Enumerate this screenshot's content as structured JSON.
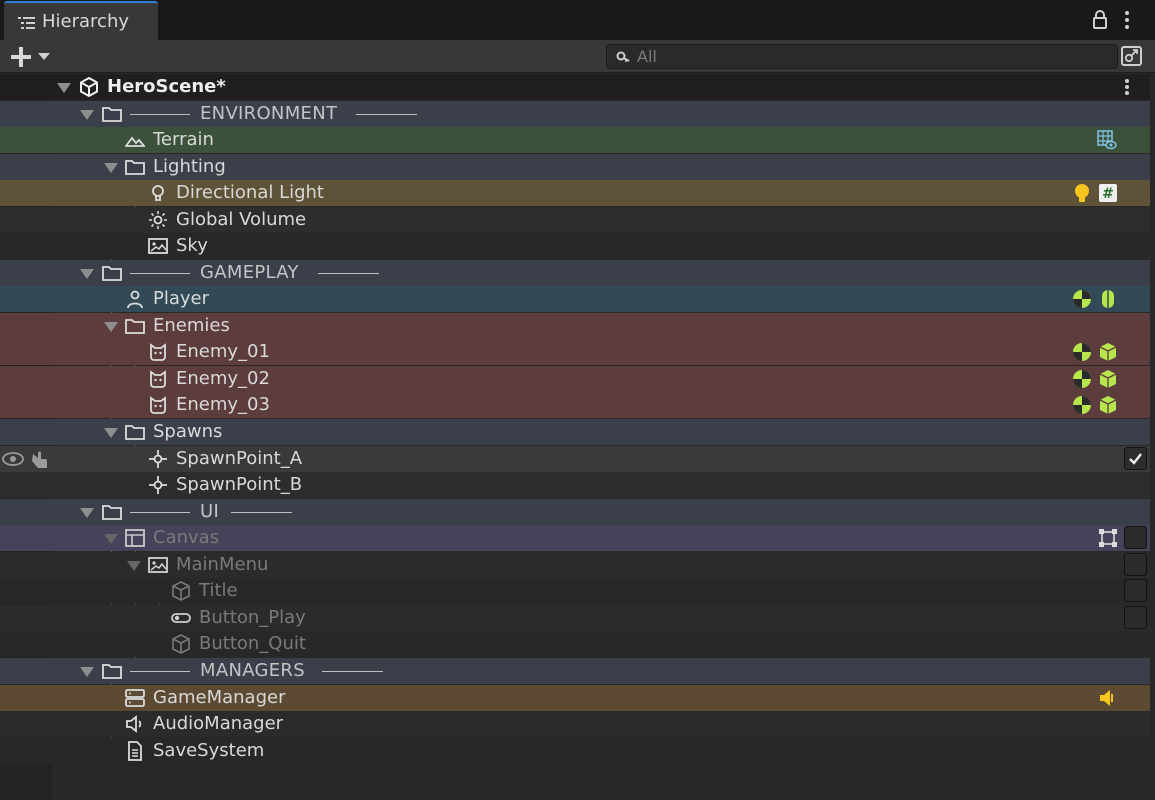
{
  "window": {
    "tab_title": "Hierarchy"
  },
  "toolbar": {
    "search_placeholder": "All"
  },
  "scene": {
    "name": "HeroScene*"
  },
  "rows": {
    "environment": "ENVIRONMENT",
    "terrain": "Terrain",
    "lighting": "Lighting",
    "directional_light": "Directional Light",
    "global_volume": "Global Volume",
    "sky": "Sky",
    "gameplay": "GAMEPLAY",
    "player": "Player",
    "enemies": "Enemies",
    "enemy_01": "Enemy_01",
    "enemy_02": "Enemy_02",
    "enemy_03": "Enemy_03",
    "spawns": "Spawns",
    "spawnpoint_a": "SpawnPoint_A",
    "spawnpoint_b": "SpawnPoint_B",
    "ui": "UI",
    "canvas": "Canvas",
    "mainmenu": "MainMenu",
    "title": "Title",
    "button_play": "Button_Play",
    "button_quit": "Button_Quit",
    "managers": "MANAGERS",
    "gamemanager": "GameManager",
    "audiomanager": "AudioManager",
    "savesystem": "SaveSystem"
  },
  "colors": {
    "header_row": "#3a3f4a",
    "terrain_row": "#3b5139",
    "light_row": "#5e5338",
    "player_row": "#314a56",
    "enemy_row": "#5c3c3c",
    "canvas_row": "#45425a",
    "gamemanager_row": "#5c4a33",
    "selected_row": "#3a3a3a",
    "accent_green": "#b7e64c",
    "accent_yellow": "#f7c520",
    "accent_blue": "#7fc4e8"
  },
  "icons": {
    "row_toggles": [
      "checkbox-checked-icon",
      "checkbox-empty-icon"
    ],
    "components": [
      "grid-eye-icon",
      "bulb-icon",
      "hash-script-icon",
      "physics-ball-icon",
      "capsule-icon",
      "cube-icon",
      "rect-transform-icon",
      "speaker-icon"
    ]
  }
}
